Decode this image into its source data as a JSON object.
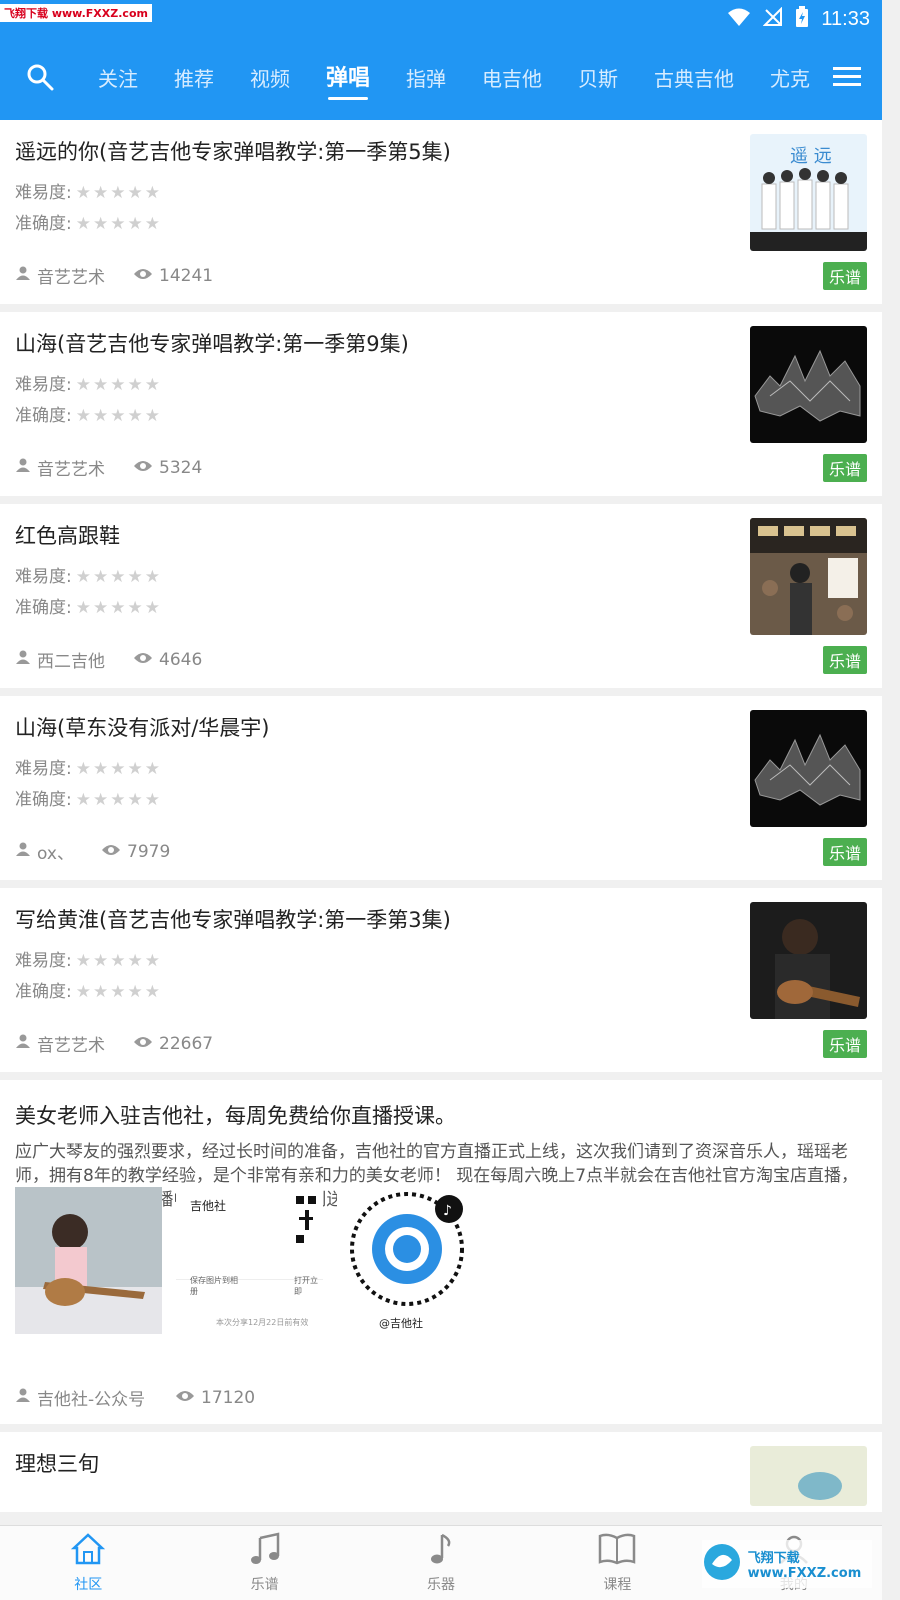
{
  "status": {
    "watermark": "飞翔下载 www.FXXZ.com",
    "time": "11:33"
  },
  "nav": {
    "tabs": [
      "关注",
      "推荐",
      "视频",
      "弹唱",
      "指弹",
      "电吉他",
      "贝斯",
      "古典吉他",
      "尤克"
    ],
    "active": "弹唱"
  },
  "cards": [
    {
      "title": "遥远的你(音艺吉他专家弹唱教学:第一季第5集)",
      "difficulty_label": "难易度:",
      "accuracy_label": "准确度:",
      "author": "音艺艺术",
      "views": "14241",
      "tag": "乐谱"
    },
    {
      "title": "山海(音艺吉他专家弹唱教学:第一季第9集)",
      "difficulty_label": "难易度:",
      "accuracy_label": "准确度:",
      "author": "音艺艺术",
      "views": "5324",
      "tag": "乐谱"
    },
    {
      "title": "红色高跟鞋",
      "difficulty_label": "难易度:",
      "accuracy_label": "准确度:",
      "author": "西二吉他",
      "views": "4646",
      "tag": "乐谱"
    },
    {
      "title": "山海(草东没有派对/华晨宇)",
      "difficulty_label": "难易度:",
      "accuracy_label": "准确度:",
      "author": "ox、",
      "views": "7979",
      "tag": "乐谱"
    },
    {
      "title": "写给黄淮(音艺吉他专家弹唱教学:第一季第3集)",
      "difficulty_label": "难易度:",
      "accuracy_label": "准确度:",
      "author": "音艺艺术",
      "views": "22667",
      "tag": "乐谱"
    }
  ],
  "post": {
    "title": "美女老师入驻吉他社，每周免费给你直播授课。",
    "body": "应广大琴友的强烈要求，经过长时间的准备，吉他社的官方直播正式上线，这次我们请到了资深音乐人，瑶瑶老师，拥有8年的教学经验，是个非常有亲和力的美女老师！ 现在每周六晚上7点半就会在吉他社官方淘宝店直播，免费观看的哦！  直播中会有不定期的福利送",
    "img2_title": "吉他社",
    "img2_save": "保存图片到相册",
    "img2_open": "打开立即",
    "img2_foot": "本次分享12月22日前有效",
    "img3_caption": "@吉他社",
    "author": "吉他社-公众号",
    "views": "17120"
  },
  "partial_card": {
    "title": "理想三旬"
  },
  "bottom": [
    "社区",
    "乐谱",
    "乐器",
    "课程",
    "我的"
  ],
  "overlay_watermark": "飞翔下载 www.FXXZ.com",
  "colors": {
    "primary": "#2196F3",
    "tag_green": "#4CAF50"
  }
}
